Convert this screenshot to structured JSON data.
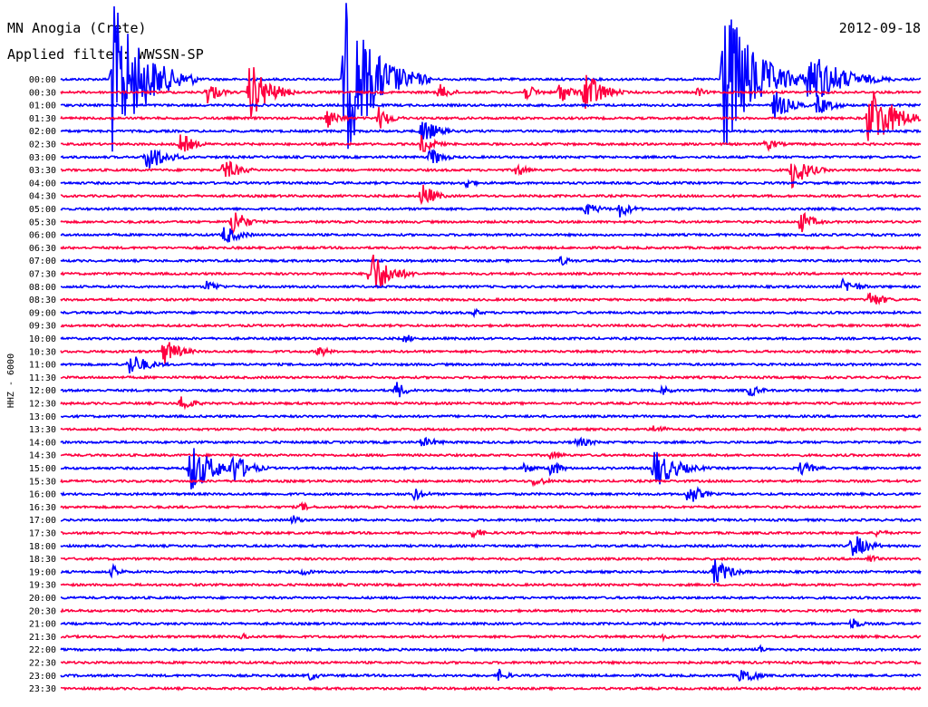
{
  "header": {
    "station": "MN Anogia (Crete)",
    "filter": "Applied filter: WWSSN-SP",
    "date": "2012-09-18"
  },
  "chart_data": {
    "type": "line",
    "title": "MN Anogia (Crete)",
    "subtitle": "Applied filter: WWSSN-SP",
    "date": "2012-09-18",
    "ylabel": "HHZ - 6000",
    "xlabel": "",
    "tick_labels": [
      "00:00",
      "00:30",
      "01:00",
      "01:30",
      "02:00",
      "02:30",
      "03:00",
      "03:30",
      "04:00",
      "04:30",
      "05:00",
      "05:30",
      "06:00",
      "06:30",
      "07:00",
      "07:30",
      "08:00",
      "08:30",
      "09:00",
      "09:30",
      "10:00",
      "10:30",
      "11:00",
      "11:30",
      "12:00",
      "12:30",
      "13:00",
      "13:30",
      "14:00",
      "14:30",
      "15:00",
      "15:30",
      "16:00",
      "16:30",
      "17:00",
      "17:30",
      "18:00",
      "18:30",
      "19:00",
      "19:30",
      "20:00",
      "20:30",
      "21:00",
      "21:30",
      "22:00",
      "22:30",
      "23:00",
      "23:30"
    ],
    "series_colors": [
      "#0000ff",
      "#ff0040"
    ],
    "grid": false,
    "legend": "none",
    "traces_minutes_per_line": 30,
    "events": [
      {
        "row": 0,
        "t": 0.06,
        "amp": 90,
        "dur": 0.1
      },
      {
        "row": 0,
        "t": 0.33,
        "amp": 90,
        "dur": 0.1
      },
      {
        "row": 0,
        "t": 0.77,
        "amp": 95,
        "dur": 0.1
      },
      {
        "row": 0,
        "t": 0.87,
        "amp": 35,
        "dur": 0.1
      },
      {
        "row": 1,
        "t": 0.17,
        "amp": 14,
        "dur": 0.04
      },
      {
        "row": 1,
        "t": 0.22,
        "amp": 35,
        "dur": 0.06
      },
      {
        "row": 1,
        "t": 0.44,
        "amp": 10,
        "dur": 0.04
      },
      {
        "row": 1,
        "t": 0.54,
        "amp": 10,
        "dur": 0.04
      },
      {
        "row": 1,
        "t": 0.58,
        "amp": 14,
        "dur": 0.04
      },
      {
        "row": 1,
        "t": 0.61,
        "amp": 30,
        "dur": 0.05
      },
      {
        "row": 1,
        "t": 0.74,
        "amp": 6,
        "dur": 0.03
      },
      {
        "row": 2,
        "t": 0.83,
        "amp": 18,
        "dur": 0.05
      },
      {
        "row": 2,
        "t": 0.88,
        "amp": 12,
        "dur": 0.05
      },
      {
        "row": 3,
        "t": 0.31,
        "amp": 12,
        "dur": 0.04
      },
      {
        "row": 3,
        "t": 0.37,
        "amp": 14,
        "dur": 0.04
      },
      {
        "row": 3,
        "t": 0.94,
        "amp": 40,
        "dur": 0.08
      },
      {
        "row": 4,
        "t": 0.42,
        "amp": 16,
        "dur": 0.05
      },
      {
        "row": 5,
        "t": 0.14,
        "amp": 14,
        "dur": 0.04
      },
      {
        "row": 5,
        "t": 0.42,
        "amp": 12,
        "dur": 0.04
      },
      {
        "row": 5,
        "t": 0.82,
        "amp": 8,
        "dur": 0.04
      },
      {
        "row": 6,
        "t": 0.1,
        "amp": 18,
        "dur": 0.06
      },
      {
        "row": 6,
        "t": 0.43,
        "amp": 12,
        "dur": 0.04
      },
      {
        "row": 7,
        "t": 0.19,
        "amp": 14,
        "dur": 0.05
      },
      {
        "row": 7,
        "t": 0.53,
        "amp": 8,
        "dur": 0.04
      },
      {
        "row": 7,
        "t": 0.85,
        "amp": 22,
        "dur": 0.05
      },
      {
        "row": 8,
        "t": 0.47,
        "amp": 8,
        "dur": 0.03
      },
      {
        "row": 9,
        "t": 0.42,
        "amp": 16,
        "dur": 0.04
      },
      {
        "row": 10,
        "t": 0.61,
        "amp": 8,
        "dur": 0.05
      },
      {
        "row": 10,
        "t": 0.65,
        "amp": 10,
        "dur": 0.04
      },
      {
        "row": 11,
        "t": 0.2,
        "amp": 18,
        "dur": 0.04
      },
      {
        "row": 11,
        "t": 0.86,
        "amp": 14,
        "dur": 0.04
      },
      {
        "row": 12,
        "t": 0.19,
        "amp": 12,
        "dur": 0.05
      },
      {
        "row": 14,
        "t": 0.58,
        "amp": 6,
        "dur": 0.04
      },
      {
        "row": 15,
        "t": 0.36,
        "amp": 30,
        "dur": 0.06
      },
      {
        "row": 16,
        "t": 0.17,
        "amp": 8,
        "dur": 0.04
      },
      {
        "row": 16,
        "t": 0.91,
        "amp": 10,
        "dur": 0.05
      },
      {
        "row": 17,
        "t": 0.94,
        "amp": 10,
        "dur": 0.05
      },
      {
        "row": 18,
        "t": 0.48,
        "amp": 5,
        "dur": 0.03
      },
      {
        "row": 20,
        "t": 0.4,
        "amp": 6,
        "dur": 0.03
      },
      {
        "row": 21,
        "t": 0.12,
        "amp": 16,
        "dur": 0.05
      },
      {
        "row": 21,
        "t": 0.3,
        "amp": 8,
        "dur": 0.03
      },
      {
        "row": 22,
        "t": 0.08,
        "amp": 14,
        "dur": 0.06
      },
      {
        "row": 24,
        "t": 0.39,
        "amp": 12,
        "dur": 0.03
      },
      {
        "row": 24,
        "t": 0.7,
        "amp": 6,
        "dur": 0.03
      },
      {
        "row": 24,
        "t": 0.8,
        "amp": 8,
        "dur": 0.04
      },
      {
        "row": 25,
        "t": 0.14,
        "amp": 10,
        "dur": 0.04
      },
      {
        "row": 27,
        "t": 0.69,
        "amp": 6,
        "dur": 0.04
      },
      {
        "row": 28,
        "t": 0.42,
        "amp": 6,
        "dur": 0.06
      },
      {
        "row": 28,
        "t": 0.6,
        "amp": 6,
        "dur": 0.06
      },
      {
        "row": 29,
        "t": 0.57,
        "amp": 6,
        "dur": 0.04
      },
      {
        "row": 30,
        "t": 0.15,
        "amp": 30,
        "dur": 0.08
      },
      {
        "row": 30,
        "t": 0.2,
        "amp": 20,
        "dur": 0.05
      },
      {
        "row": 30,
        "t": 0.54,
        "amp": 8,
        "dur": 0.03
      },
      {
        "row": 30,
        "t": 0.57,
        "amp": 12,
        "dur": 0.03
      },
      {
        "row": 30,
        "t": 0.69,
        "amp": 24,
        "dur": 0.07
      },
      {
        "row": 30,
        "t": 0.86,
        "amp": 8,
        "dur": 0.05
      },
      {
        "row": 31,
        "t": 0.55,
        "amp": 6,
        "dur": 0.05
      },
      {
        "row": 32,
        "t": 0.41,
        "amp": 8,
        "dur": 0.04
      },
      {
        "row": 32,
        "t": 0.73,
        "amp": 14,
        "dur": 0.04
      },
      {
        "row": 33,
        "t": 0.28,
        "amp": 6,
        "dur": 0.03
      },
      {
        "row": 34,
        "t": 0.27,
        "amp": 6,
        "dur": 0.03
      },
      {
        "row": 35,
        "t": 0.48,
        "amp": 8,
        "dur": 0.03
      },
      {
        "row": 35,
        "t": 0.95,
        "amp": 6,
        "dur": 0.03
      },
      {
        "row": 36,
        "t": 0.92,
        "amp": 16,
        "dur": 0.05
      },
      {
        "row": 37,
        "t": 0.94,
        "amp": 6,
        "dur": 0.03
      },
      {
        "row": 38,
        "t": 0.06,
        "amp": 8,
        "dur": 0.03
      },
      {
        "row": 38,
        "t": 0.28,
        "amp": 6,
        "dur": 0.03
      },
      {
        "row": 38,
        "t": 0.76,
        "amp": 16,
        "dur": 0.05
      },
      {
        "row": 42,
        "t": 0.92,
        "amp": 8,
        "dur": 0.03
      },
      {
        "row": 43,
        "t": 0.21,
        "amp": 5,
        "dur": 0.03
      },
      {
        "row": 43,
        "t": 0.7,
        "amp": 4,
        "dur": 0.03
      },
      {
        "row": 44,
        "t": 0.81,
        "amp": 6,
        "dur": 0.03
      },
      {
        "row": 46,
        "t": 0.29,
        "amp": 6,
        "dur": 0.03
      },
      {
        "row": 46,
        "t": 0.51,
        "amp": 8,
        "dur": 0.03
      },
      {
        "row": 46,
        "t": 0.79,
        "amp": 8,
        "dur": 0.03
      },
      {
        "row": 46,
        "t": 0.8,
        "amp": 10,
        "dur": 0.03
      }
    ]
  }
}
